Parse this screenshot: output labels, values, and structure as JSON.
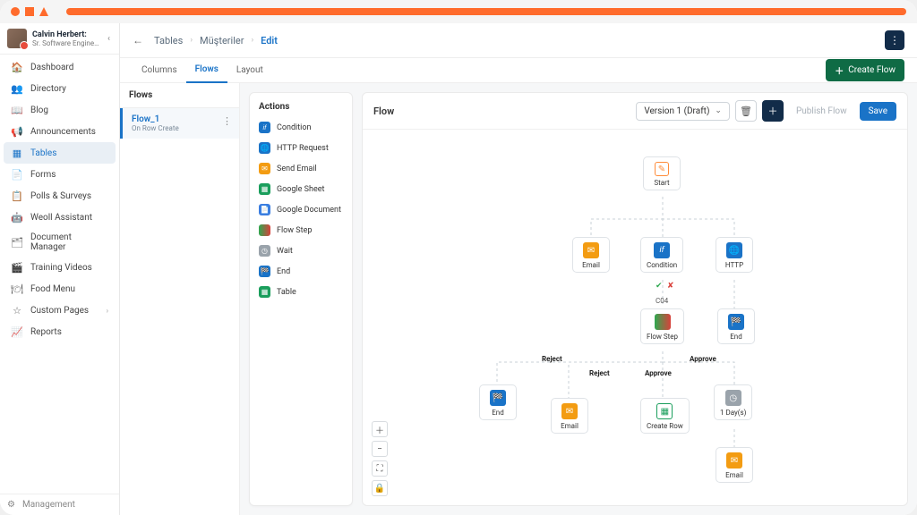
{
  "user": {
    "name": "Calvin Herbert:",
    "role": "Sr. Software Engineer"
  },
  "sidebar": {
    "items": [
      {
        "label": "Dashboard",
        "icon": "🏠"
      },
      {
        "label": "Directory",
        "icon": "👥"
      },
      {
        "label": "Blog",
        "icon": "📖"
      },
      {
        "label": "Announcements",
        "icon": "📢"
      },
      {
        "label": "Tables",
        "icon": "▦",
        "active": true
      },
      {
        "label": "Forms",
        "icon": "📄"
      },
      {
        "label": "Polls & Surveys",
        "icon": "📋"
      },
      {
        "label": "Weoll Assistant",
        "icon": "🤖"
      },
      {
        "label": "Document Manager",
        "icon": "🗂"
      },
      {
        "label": "Training Videos",
        "icon": "🎬"
      },
      {
        "label": "Food Menu",
        "icon": "🍽"
      },
      {
        "label": "Custom Pages",
        "icon": "☆",
        "caret": true
      },
      {
        "label": "Reports",
        "icon": "📈"
      }
    ],
    "bottom": {
      "label": "Management",
      "icon": "⚙"
    }
  },
  "breadcrumb": {
    "items": [
      "Tables",
      "Müşteriler",
      "Edit"
    ]
  },
  "tabs": {
    "items": [
      "Columns",
      "Flows",
      "Layout"
    ],
    "active": 1,
    "create": "Create Flow"
  },
  "flows_panel": {
    "title": "Flows",
    "item": {
      "name": "Flow_1",
      "sub": "On Row Create"
    }
  },
  "actions_panel": {
    "title": "Actions",
    "items": [
      {
        "label": "Condition",
        "color": "#1a73c7",
        "glyph": "if"
      },
      {
        "label": "HTTP Request",
        "color": "#1a73c7",
        "glyph": "🌐"
      },
      {
        "label": "Send Email",
        "color": "#f39c12",
        "glyph": "✉"
      },
      {
        "label": "Google Sheet",
        "color": "#1a9e5c",
        "glyph": "▦"
      },
      {
        "label": "Google Document",
        "color": "#3a7de0",
        "glyph": "📄"
      },
      {
        "label": "Flow Step",
        "color": "linear-gradient(90deg,#2ea84f,#d9413b)",
        "glyph": "⬤"
      },
      {
        "label": "Wait",
        "color": "#9aa3ab",
        "glyph": "◷"
      },
      {
        "label": "End",
        "color": "#1a73c7",
        "glyph": "🏁",
        "checker": "#1a73c7"
      },
      {
        "label": "Table",
        "color": "#1a9e5c",
        "glyph": "▦"
      }
    ]
  },
  "canvas": {
    "title": "Flow",
    "version": "Version 1 (Draft)",
    "publish": "Publish Flow",
    "save": "Save"
  },
  "nodes": {
    "start": {
      "label": "Start"
    },
    "email1": {
      "label": "Email"
    },
    "condition": {
      "label": "Condition"
    },
    "http": {
      "label": "HTTP"
    },
    "c04": {
      "label": "C04"
    },
    "flowstep": {
      "label": "Flow Step"
    },
    "end_http": {
      "label": "End"
    },
    "end_left": {
      "label": "End"
    },
    "email2": {
      "label": "Email"
    },
    "createrow": {
      "label": "Create Row"
    },
    "wait": {
      "label": "1 Day(s)"
    },
    "email3": {
      "label": "Email"
    }
  },
  "labels": {
    "reject": "Reject",
    "approve": "Approve"
  }
}
